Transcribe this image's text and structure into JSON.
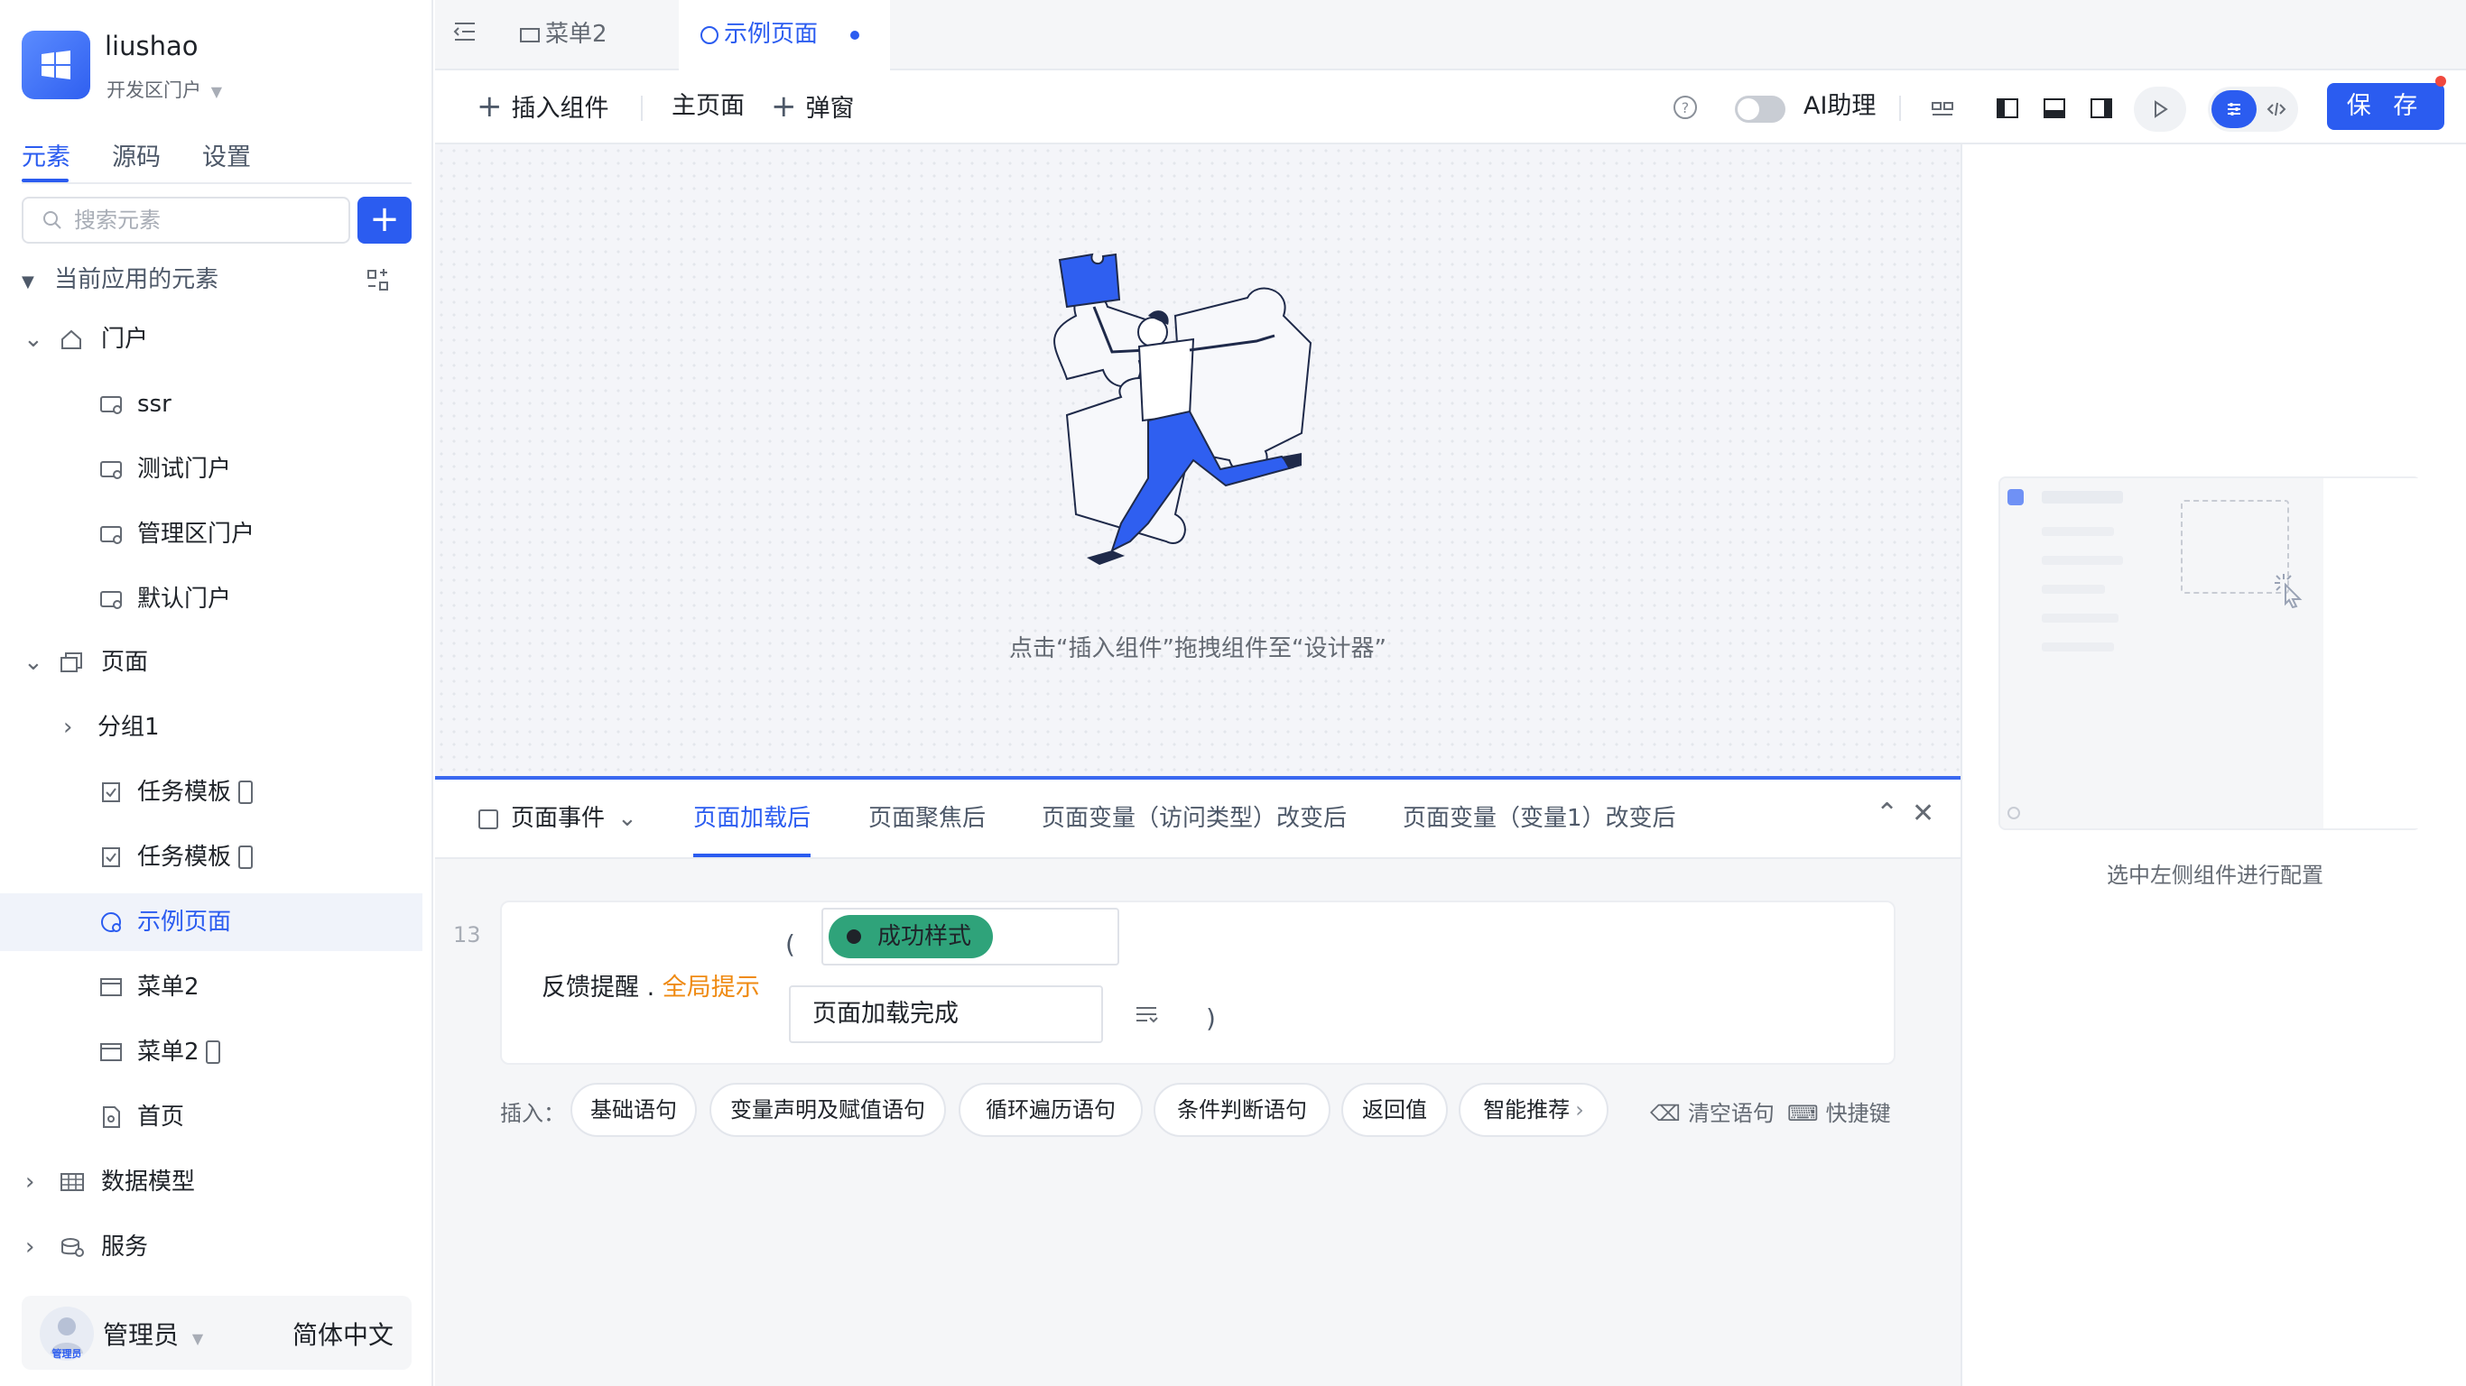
{
  "sidebar": {
    "app_name": "liushao",
    "app_sub": "开发区门户",
    "tabs": [
      "元素",
      "源码",
      "设置"
    ],
    "search_placeholder": "搜索元素",
    "section_title": "当前应用的元素",
    "tree": [
      {
        "label": "门户",
        "icon": "home-icon"
      },
      {
        "label": "ssr",
        "icon": "portal-icon"
      },
      {
        "label": "测试门户",
        "icon": "portal-icon"
      },
      {
        "label": "管理区门户",
        "icon": "portal-icon"
      },
      {
        "label": "默认门户",
        "icon": "portal-icon"
      },
      {
        "label": "页面",
        "icon": "pages-icon"
      },
      {
        "label": "分组1",
        "icon": "chevron-right-icon"
      },
      {
        "label": "任务模板",
        "icon": "form-icon"
      },
      {
        "label": "任务模板",
        "icon": "form-icon"
      },
      {
        "label": "示例页面",
        "icon": "page-design-icon"
      },
      {
        "label": "菜单2",
        "icon": "window-icon"
      },
      {
        "label": "菜单2",
        "icon": "window-icon"
      },
      {
        "label": "首页",
        "icon": "doc-icon"
      },
      {
        "label": "数据模型",
        "icon": "table-icon"
      },
      {
        "label": "服务",
        "icon": "service-icon"
      }
    ],
    "user": {
      "avatar_text": "管理员",
      "name": "管理员",
      "language": "简体中文"
    }
  },
  "page_tabs": [
    {
      "label": "菜单2",
      "active": false
    },
    {
      "label": "示例页面",
      "active": true
    }
  ],
  "toolbar": {
    "insert": "插入组件",
    "main_page": "主页面",
    "popup": "弹窗",
    "ai_label": "AI助理",
    "save": "保 存"
  },
  "canvas": {
    "hint": "点击“插入组件”拖拽组件至“设计器”"
  },
  "right_panel": {
    "hint": "选中左侧组件进行配置"
  },
  "events": {
    "dropdown": "页面事件",
    "tabs": [
      "页面加载后",
      "页面聚焦后",
      "页面变量（访问类型）改变后",
      "页面变量（变量1）改变后"
    ],
    "active_tab": 0,
    "code": {
      "line_no": "13",
      "prefix": "反馈提醒 .",
      "method": "全局提示",
      "open_paren": "(",
      "tag": "成功样式",
      "message": "页面加载完成",
      "close_paren": ")"
    },
    "insert_label": "插入：",
    "chips": [
      "基础语句",
      "变量声明及赋值语句",
      "循环遍历语句",
      "条件判断语句",
      "返回值",
      "智能推荐"
    ],
    "clear": "清空语句",
    "shortcut": "快捷键"
  },
  "colors": {
    "primary": "#2b5cf0",
    "success": "#2fa37a",
    "orange": "#ef8a12"
  }
}
